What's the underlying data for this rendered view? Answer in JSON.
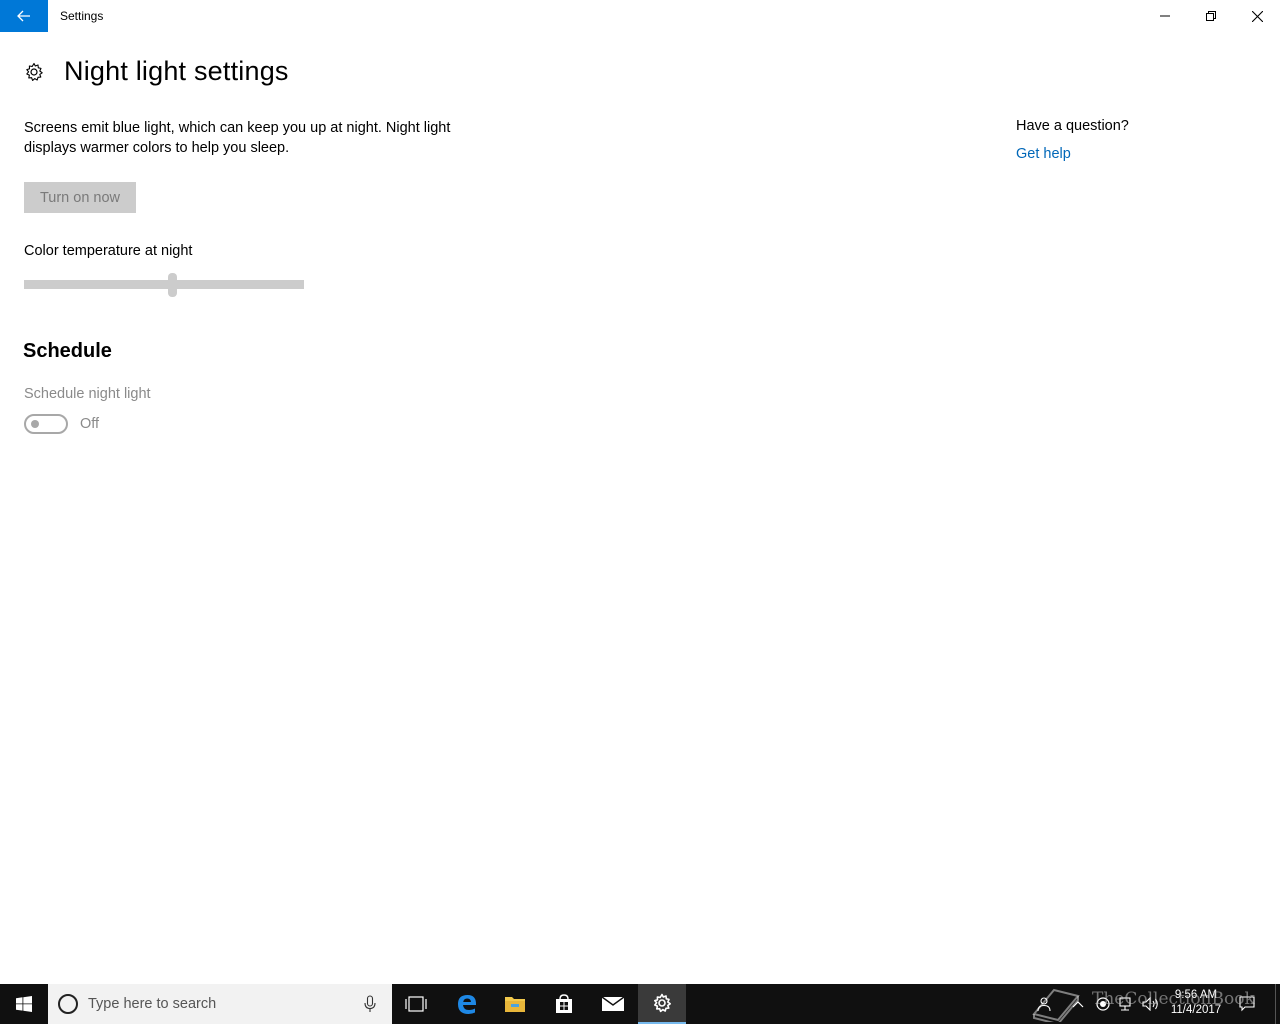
{
  "window": {
    "title": "Settings",
    "controls": {
      "minimize": "minimize",
      "maximize": "restore",
      "close": "close"
    }
  },
  "page": {
    "title": "Night light settings",
    "description": "Screens emit blue light, which can keep you up at night. Night light displays warmer colors to help you sleep.",
    "turn_on_button": "Turn on now",
    "slider_label": "Color temperature at night",
    "slider_level_percent": 53,
    "schedule_heading": "Schedule",
    "schedule_toggle_label": "Schedule night light",
    "schedule_toggle_state": "Off"
  },
  "help": {
    "heading": "Have a question?",
    "link": "Get help"
  },
  "taskbar": {
    "search_placeholder": "Type here to search",
    "apps": [
      "task-view",
      "edge",
      "file-explorer",
      "store",
      "mail",
      "settings"
    ],
    "active_app": "settings",
    "clock_time": "9:56 AM",
    "clock_date": "11/4/2017",
    "watermark": "TheCollectionBook"
  },
  "colors": {
    "accent": "#0078d7",
    "link": "#0067b8",
    "disabled_control": "#cccccc",
    "taskbar": "#101010"
  },
  "icons": [
    "back-arrow-icon",
    "minimize-icon",
    "restore-icon",
    "close-icon",
    "gear-icon",
    "windows-logo-icon",
    "cortana-icon",
    "microphone-icon",
    "task-view-icon",
    "edge-icon",
    "folder-icon",
    "store-icon",
    "mail-icon",
    "settings-gear-icon",
    "people-icon",
    "chevron-up-icon",
    "network-icon",
    "volume-icon",
    "action-center-icon"
  ]
}
